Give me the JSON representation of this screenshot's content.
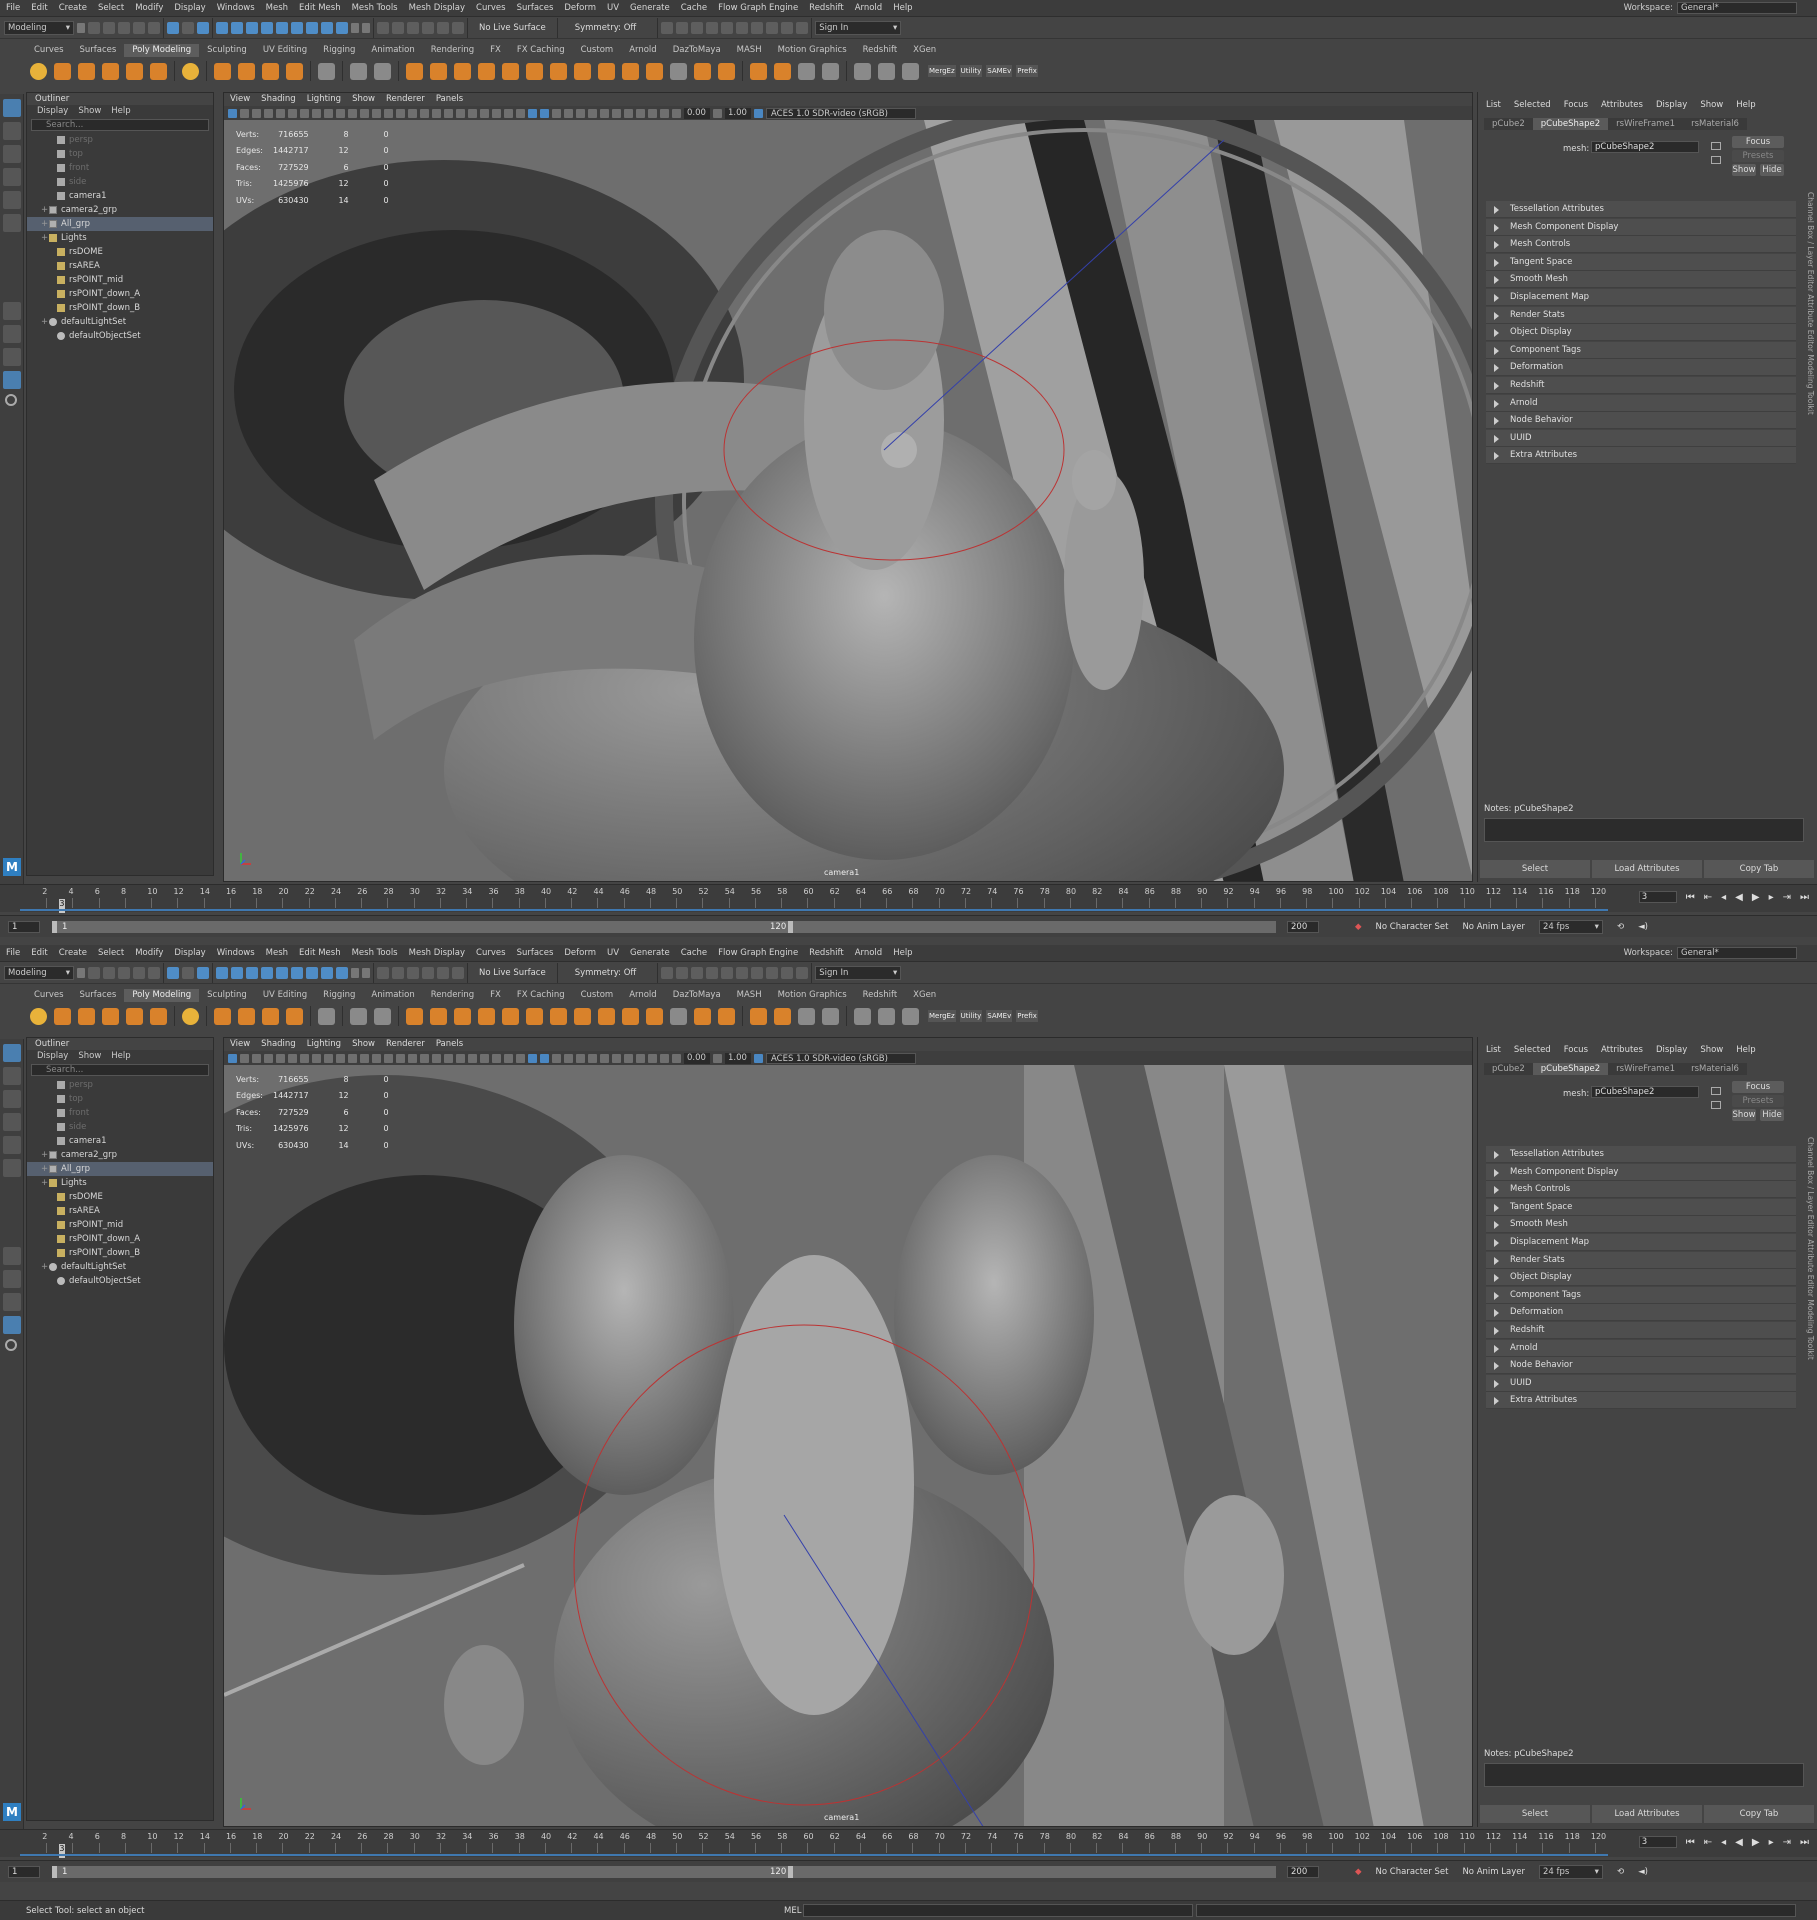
{
  "menus": [
    "File",
    "Edit",
    "Create",
    "Select",
    "Modify",
    "Display",
    "Windows",
    "Mesh",
    "Edit Mesh",
    "Mesh Tools",
    "Mesh Display",
    "Curves",
    "Surfaces",
    "Deform",
    "UV",
    "Generate",
    "Cache",
    "Flow Graph Engine",
    "Redshift",
    "Arnold",
    "Help"
  ],
  "workspace": {
    "label": "Workspace:",
    "value": "General*"
  },
  "status": {
    "mode": "Modeling",
    "live_surface": "No Live Surface",
    "symmetry": "Symmetry: Off",
    "sign_in": "Sign In"
  },
  "shelf_tabs": [
    "Curves",
    "Surfaces",
    "Poly Modeling",
    "Sculpting",
    "UV Editing",
    "Rigging",
    "Animation",
    "Rendering",
    "FX",
    "FX Caching",
    "Custom",
    "Arnold",
    "DazToMaya",
    "MASH",
    "Motion Graphics",
    "Redshift",
    "XGen"
  ],
  "shelf_active": "Poly Modeling",
  "shelf_labels": [
    "MergEz",
    "Utility",
    "SAMEv",
    "Prefix"
  ],
  "outliner": {
    "title": "Outliner",
    "menu": [
      "Display",
      "Show",
      "Help"
    ],
    "search_placeholder": "Search...",
    "items": [
      {
        "label": "persp",
        "dim": true
      },
      {
        "label": "top",
        "dim": true
      },
      {
        "label": "front",
        "dim": true
      },
      {
        "label": "side",
        "dim": true
      },
      {
        "label": "camera1"
      },
      {
        "label": "camera2_grp"
      },
      {
        "label": "All_grp"
      },
      {
        "label": "Lights"
      },
      {
        "label": "rsDOME"
      },
      {
        "label": "rsAREA"
      },
      {
        "label": "rsPOINT_mid"
      },
      {
        "label": "rsPOINT_down_A"
      },
      {
        "label": "rsPOINT_down_B"
      },
      {
        "label": "defaultLightSet"
      },
      {
        "label": "defaultObjectSet"
      }
    ]
  },
  "viewport": {
    "menu": [
      "View",
      "Shading",
      "Lighting",
      "Show",
      "Renderer",
      "Panels"
    ],
    "exposure": "0.00",
    "gamma": "1.00",
    "colorspace": "ACES 1.0 SDR-video (sRGB)",
    "camera": "camera1",
    "hud": [
      {
        "label": "Verts:",
        "total": "716655",
        "sel": "8",
        "comp": "0"
      },
      {
        "label": "Edges:",
        "total": "1442717",
        "sel": "12",
        "comp": "0"
      },
      {
        "label": "Faces:",
        "total": "727529",
        "sel": "6",
        "comp": "0"
      },
      {
        "label": "Tris:",
        "total": "1425976",
        "sel": "12",
        "comp": "0"
      },
      {
        "label": "UVs:",
        "total": "630430",
        "sel": "14",
        "comp": "0"
      }
    ]
  },
  "attr": {
    "menu": [
      "List",
      "Selected",
      "Focus",
      "Attributes",
      "Display",
      "Show",
      "Help"
    ],
    "tabs": [
      "pCube2",
      "pCubeShape2",
      "rsWireFrame1",
      "rsMaterial6"
    ],
    "active_tab": "pCubeShape2",
    "mesh_label": "mesh:",
    "mesh_value": "pCubeShape2",
    "focus": "Focus",
    "presets": "Presets",
    "show": "Show",
    "hide": "Hide",
    "sections": [
      "Tessellation Attributes",
      "Mesh Component Display",
      "Mesh Controls",
      "Tangent Space",
      "Smooth Mesh",
      "Displacement Map",
      "Render Stats",
      "Object Display",
      "Component Tags",
      "Deformation",
      "Redshift",
      "Arnold",
      "Node Behavior",
      "UUID",
      "Extra Attributes"
    ],
    "notes": "Notes:  pCubeShape2",
    "buttons": [
      "Select",
      "Load Attributes",
      "Copy Tab"
    ],
    "side_tabs": "Channel Box / Layer Editor   Attribute Editor   Modeling Toolkit"
  },
  "timeline": {
    "ticks": [
      "2",
      "4",
      "6",
      "8",
      "10",
      "12",
      "14",
      "16",
      "18",
      "20",
      "22",
      "24",
      "26",
      "28",
      "30",
      "32",
      "34",
      "36",
      "38",
      "40",
      "42",
      "44",
      "46",
      "48",
      "50",
      "52",
      "54",
      "56",
      "58",
      "60",
      "62",
      "64",
      "66",
      "68",
      "70",
      "72",
      "74",
      "76",
      "78",
      "80",
      "82",
      "84",
      "86",
      "88",
      "90",
      "92",
      "94",
      "96",
      "98",
      "100",
      "102",
      "104",
      "106",
      "108",
      "110",
      "112",
      "114",
      "116",
      "118",
      "120"
    ],
    "current": "3",
    "current_frame_field": "3"
  },
  "range": {
    "start": "1",
    "inner_start": "1",
    "inner_end": "120",
    "end": "200",
    "char_set": "No Character Set",
    "anim_layer": "No Anim Layer",
    "fps": "24 fps"
  },
  "cmd": {
    "status": "Select Tool: select an object",
    "mel": "MEL"
  }
}
